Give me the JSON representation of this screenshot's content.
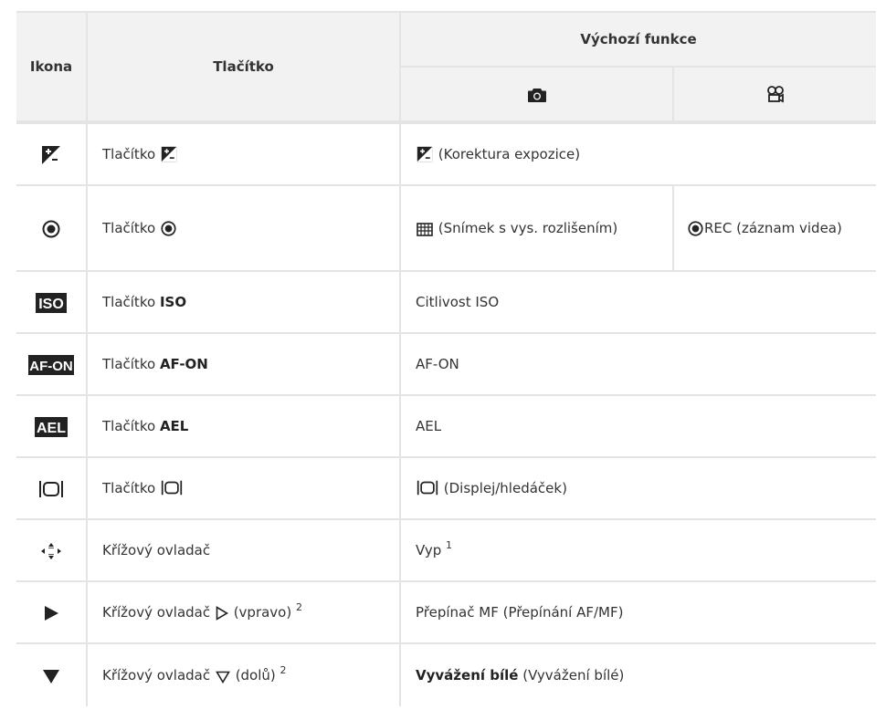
{
  "header": {
    "col_icon": "Ikona",
    "col_button": "Tlačítko",
    "col_default": "Výchozí funkce",
    "sub_photo_icon": "camera-icon",
    "sub_movie_icon": "movie-camera-icon"
  },
  "rows": [
    {
      "icon": "exposure-compensation-icon",
      "button_prefix": "Tlačítko",
      "button_bold": "",
      "button_icon": "exposure-compensation-icon",
      "button_suffix": "",
      "default": "(Korektura expozice)",
      "default_icon": "exposure-compensation-icon"
    },
    {
      "icon": "record-icon",
      "button_prefix": "Tlačítko",
      "button_bold": "",
      "button_icon": "record-icon",
      "photo": "(Snímek s vys. rozlišením)",
      "photo_icon": "high-res-shot-icon",
      "movie": "REC (záznam videa)",
      "movie_icon": "record-icon"
    },
    {
      "icon": "iso-icon",
      "icon_text": "ISO",
      "button_prefix": "Tlačítko",
      "button_bold": "ISO",
      "default": "Citlivost ISO"
    },
    {
      "icon": "af-on-icon",
      "icon_text": "AF-ON",
      "button_prefix": "Tlačítko",
      "button_bold": "AF-ON",
      "default": "AF-ON"
    },
    {
      "icon": "ael-icon",
      "icon_text": "AEL",
      "button_prefix": "Tlačítko",
      "button_bold": "AEL",
      "default": "AEL"
    },
    {
      "icon": "display-toggle-icon",
      "button_prefix": "Tlačítko",
      "button_icon": "display-toggle-icon",
      "default": "(Displej/hledáček)",
      "default_icon": "display-toggle-icon"
    },
    {
      "icon": "arrow-pad-icon",
      "button_prefix": "Křížový ovladač",
      "default": "Vyp",
      "default_sup": "1"
    },
    {
      "icon": "arrow-right-icon",
      "button_prefix": "Křížový ovladač",
      "button_icon": "outline-triangle-right-icon",
      "button_suffix": "(vpravo)",
      "button_sup": "2",
      "default": "Přepínač MF (Přepínání AF/MF)"
    },
    {
      "icon": "arrow-down-icon",
      "button_prefix": "Křížový ovladač",
      "button_icon": "outline-triangle-down-icon",
      "button_suffix": "(dolů)",
      "button_sup": "2",
      "default_bold": "Vyvážení bílé",
      "default": "(Vyvážení bílé)"
    }
  ]
}
